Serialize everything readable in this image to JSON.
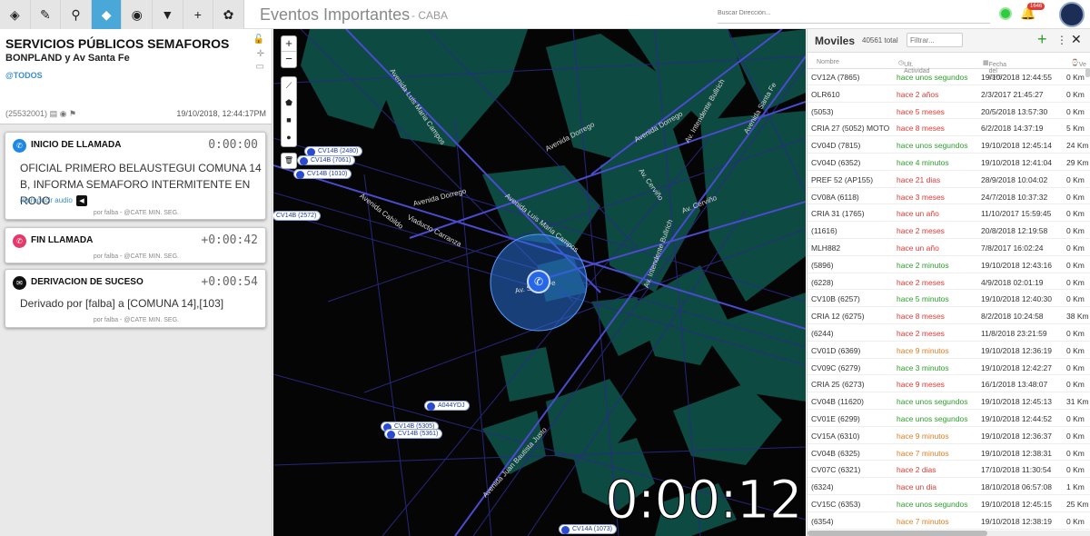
{
  "toolbar": {
    "tools": [
      {
        "name": "layers-icon",
        "glyph": "◈"
      },
      {
        "name": "pencil-icon",
        "glyph": "✎"
      },
      {
        "name": "search-icon",
        "glyph": "⚲"
      },
      {
        "name": "tag-icon",
        "glyph": "◆"
      },
      {
        "name": "eye-icon",
        "glyph": "◉"
      },
      {
        "name": "filter-icon",
        "glyph": "▼"
      },
      {
        "name": "plus-icon",
        "glyph": "+"
      },
      {
        "name": "gear-icon",
        "glyph": "✿"
      }
    ],
    "active_tool": 3
  },
  "header": {
    "title": "Eventos Importantes",
    "subtitle": "- CABA",
    "address_placeholder": "Buscar Dirección...",
    "notifications": "1646"
  },
  "event": {
    "title": "SERVICIOS PÚBLICOS SEMAFOROS",
    "address": "BONPLAND y Av Santa Fe",
    "tag": "@TODOS",
    "id": "(25532001)",
    "datetime": "19/10/2018, 12:44:17PM"
  },
  "cards": [
    {
      "title": "INICIO DE LLAMADA",
      "clock": "0:00:00",
      "body": "OFICIAL PRIMERO BELAUSTEGUI COMUNA 14 B, INFORMA SEMAFORO INTERMITENTE EN ROJO",
      "link": "reproducir audio",
      "by": "por falba - @CATE MIN. SEG.",
      "color": "#1e88e5"
    },
    {
      "title": "FIN LLAMADA",
      "clock": "+0:00:42",
      "by": "por falba - @CATE MIN. SEG.",
      "color": "#e5396b"
    },
    {
      "title": "DERIVACION DE SUCESO",
      "clock": "+0:00:54",
      "body": "Derivado por [falba] a [COMUNA 14],[103]",
      "by": "por falba - @CATE MIN. SEG.",
      "color": "#111111"
    }
  ],
  "map": {
    "zoom_in": "+",
    "zoom_out": "−",
    "timer": "0:00:12",
    "vehicles": [
      "CV14B (2480)",
      "CV14B (7061)",
      "CV14B (1010)",
      "CV14B (2572)",
      "A044YDJ",
      "CV14B (5305)",
      "CV14B (5361)",
      "CV14A (1073)"
    ],
    "streets": [
      "Avenida Luis Maria Campos",
      "Avenida Dorrego",
      "Avenida Cabildo",
      "Viaducto Carranza",
      "Avenida Luis Maria Campos",
      "Av. Santa Fe",
      "Av. Cerviño",
      "Av. Intendente Bullrich",
      "Avenida Juan Bautista Justo",
      "Av. Cerviño",
      "Avenida Dorrego",
      "Av. Intendente Bullrich",
      "Avenida Dorrego",
      "Avenida Santa Fe"
    ]
  },
  "moviles": {
    "title": "Moviles",
    "count": "40561 total",
    "filter_placeholder": "Filtrar...",
    "columns": [
      "Nombre",
      "Ult. Actividad",
      "Fecha del GPS",
      "Ve"
    ],
    "rows": [
      {
        "name": "CV12A (7865)",
        "act": "hace unos segundos",
        "date": "19/10/2018 12:44:55",
        "vel": "0 Km",
        "status": "green"
      },
      {
        "name": "OLR610",
        "act": "hace 2 años",
        "date": "2/3/2017 21:45:27",
        "vel": "0 Km",
        "status": "red"
      },
      {
        "name": "(5053)",
        "act": "hace 5 meses",
        "date": "20/5/2018 13:57:30",
        "vel": "0 Km",
        "status": "red"
      },
      {
        "name": "CRIA 27 (5052) MOTO",
        "act": "hace 8 meses",
        "date": "6/2/2018 14:37:19",
        "vel": "5 Km",
        "status": "red"
      },
      {
        "name": "CV04D (7815)",
        "act": "hace unos segundos",
        "date": "19/10/2018 12:45:14",
        "vel": "24 Km",
        "status": "green"
      },
      {
        "name": "CV04D (6352)",
        "act": "hace 4 minutos",
        "date": "19/10/2018 12:41:04",
        "vel": "29 Km",
        "status": "green"
      },
      {
        "name": "PREF 52 (AP155)",
        "act": "hace 21 dias",
        "date": "28/9/2018 10:04:02",
        "vel": "0 Km",
        "status": "red"
      },
      {
        "name": "CV08A (6118)",
        "act": "hace 3 meses",
        "date": "24/7/2018 10:37:32",
        "vel": "0 Km",
        "status": "red"
      },
      {
        "name": "CRIA 31 (1765)",
        "act": "hace un año",
        "date": "11/10/2017 15:59:45",
        "vel": "0 Km",
        "status": "red"
      },
      {
        "name": "(11616)",
        "act": "hace 2 meses",
        "date": "20/8/2018 12:19:58",
        "vel": "0 Km",
        "status": "red"
      },
      {
        "name": "MLH882",
        "act": "hace un año",
        "date": "7/8/2017 16:02:24",
        "vel": "0 Km",
        "status": "red"
      },
      {
        "name": "(5896)",
        "act": "hace 2 minutos",
        "date": "19/10/2018 12:43:16",
        "vel": "0 Km",
        "status": "green"
      },
      {
        "name": "(6228)",
        "act": "hace 2 meses",
        "date": "4/9/2018 02:01:19",
        "vel": "0 Km",
        "status": "red"
      },
      {
        "name": "CV10B (6257)",
        "act": "hace 5 minutos",
        "date": "19/10/2018 12:40:30",
        "vel": "0 Km",
        "status": "green"
      },
      {
        "name": "CRIA 12 (6275)",
        "act": "hace 8 meses",
        "date": "8/2/2018 10:24:58",
        "vel": "38 Km",
        "status": "red"
      },
      {
        "name": "(6244)",
        "act": "hace 2 meses",
        "date": "11/8/2018 23:21:59",
        "vel": "0 Km",
        "status": "red"
      },
      {
        "name": "CV01D (6369)",
        "act": "hace 9 minutos",
        "date": "19/10/2018 12:36:19",
        "vel": "0 Km",
        "status": "orange"
      },
      {
        "name": "CV09C (6279)",
        "act": "hace 3 minutos",
        "date": "19/10/2018 12:42:27",
        "vel": "0 Km",
        "status": "green"
      },
      {
        "name": "CRIA 25 (6273)",
        "act": "hace 9 meses",
        "date": "16/1/2018 13:48:07",
        "vel": "0 Km",
        "status": "red"
      },
      {
        "name": "CV04B (11620)",
        "act": "hace unos segundos",
        "date": "19/10/2018 12:45:13",
        "vel": "31 Km",
        "status": "green"
      },
      {
        "name": "CV01E (6299)",
        "act": "hace unos segundos",
        "date": "19/10/2018 12:44:52",
        "vel": "0 Km",
        "status": "green"
      },
      {
        "name": "CV15A (6310)",
        "act": "hace 9 minutos",
        "date": "19/10/2018 12:36:37",
        "vel": "0 Km",
        "status": "orange"
      },
      {
        "name": "CV04B (6325)",
        "act": "hace 7 minutos",
        "date": "19/10/2018 12:38:31",
        "vel": "0 Km",
        "status": "orange"
      },
      {
        "name": "CV07C (6321)",
        "act": "hace 2 dias",
        "date": "17/10/2018 11:30:54",
        "vel": "0 Km",
        "status": "red"
      },
      {
        "name": "(6324)",
        "act": "hace un dia",
        "date": "18/10/2018 06:57:08",
        "vel": "1 Km",
        "status": "red"
      },
      {
        "name": "CV15C (6353)",
        "act": "hace unos segundos",
        "date": "19/10/2018 12:45:15",
        "vel": "25 Km",
        "status": "green"
      },
      {
        "name": "(6354)",
        "act": "hace 7 minutos",
        "date": "19/10/2018 12:38:19",
        "vel": "0 Km",
        "status": "orange"
      }
    ]
  },
  "colors": {
    "accent": "#4aa8d8",
    "ok": "#2ca02c",
    "warn": "#e53935",
    "mid": "#e67e22"
  }
}
